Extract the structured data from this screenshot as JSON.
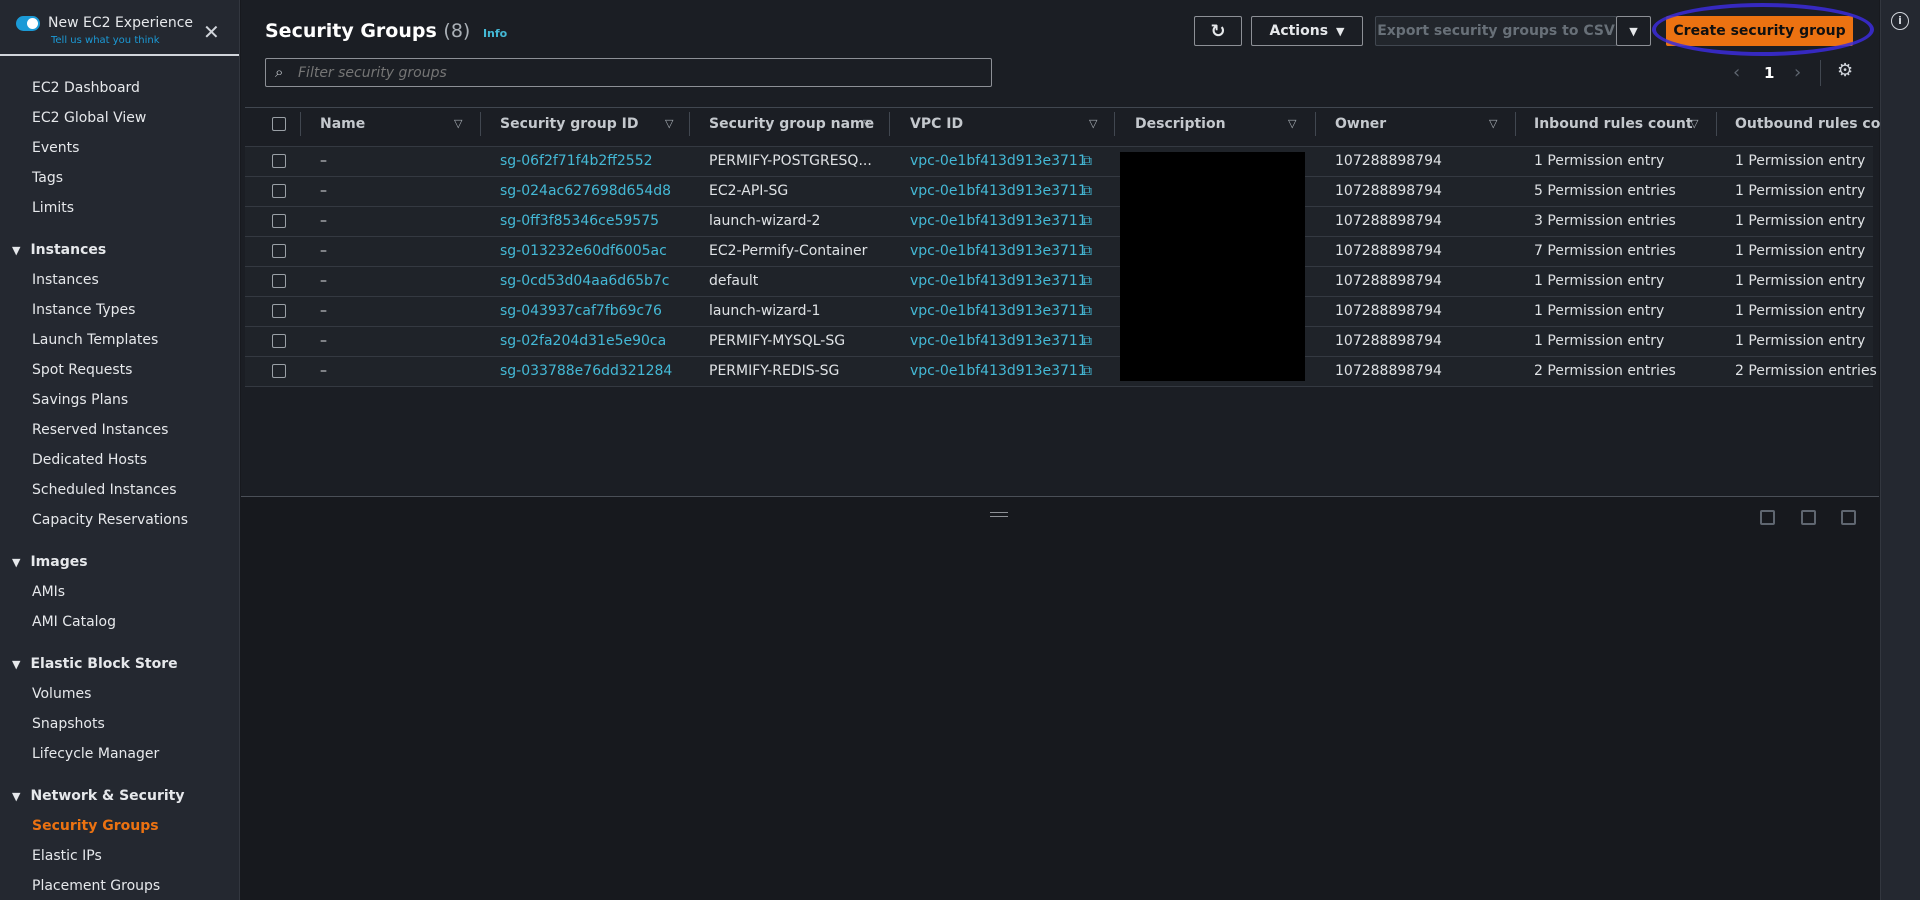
{
  "sidebar": {
    "toggle_label": "New EC2 Experience",
    "feedback_link": "Tell us what you think",
    "items": [
      {
        "label": "EC2 Dashboard",
        "type": "item"
      },
      {
        "label": "EC2 Global View",
        "type": "item"
      },
      {
        "label": "Events",
        "type": "item"
      },
      {
        "label": "Tags",
        "type": "item"
      },
      {
        "label": "Limits",
        "type": "item"
      },
      {
        "label": "Instances",
        "type": "section"
      },
      {
        "label": "Instances",
        "type": "item"
      },
      {
        "label": "Instance Types",
        "type": "item"
      },
      {
        "label": "Launch Templates",
        "type": "item"
      },
      {
        "label": "Spot Requests",
        "type": "item"
      },
      {
        "label": "Savings Plans",
        "type": "item"
      },
      {
        "label": "Reserved Instances",
        "type": "item"
      },
      {
        "label": "Dedicated Hosts",
        "type": "item"
      },
      {
        "label": "Scheduled Instances",
        "type": "item"
      },
      {
        "label": "Capacity Reservations",
        "type": "item"
      },
      {
        "label": "Images",
        "type": "section"
      },
      {
        "label": "AMIs",
        "type": "item"
      },
      {
        "label": "AMI Catalog",
        "type": "item"
      },
      {
        "label": "Elastic Block Store",
        "type": "section"
      },
      {
        "label": "Volumes",
        "type": "item"
      },
      {
        "label": "Snapshots",
        "type": "item"
      },
      {
        "label": "Lifecycle Manager",
        "type": "item"
      },
      {
        "label": "Network & Security",
        "type": "section"
      },
      {
        "label": "Security Groups",
        "type": "item",
        "active": true
      },
      {
        "label": "Elastic IPs",
        "type": "item"
      },
      {
        "label": "Placement Groups",
        "type": "item"
      }
    ]
  },
  "header": {
    "title": "Security Groups",
    "count": "(8)",
    "info": "Info"
  },
  "toolbar": {
    "actions": "Actions",
    "export": "Export security groups to CSV",
    "create": "Create security group"
  },
  "filter": {
    "placeholder": "Filter security groups",
    "value": ""
  },
  "pagination": {
    "page": "1"
  },
  "table": {
    "columns": [
      "Name",
      "Security group ID",
      "Security group name",
      "VPC ID",
      "Description",
      "Owner",
      "Inbound rules count",
      "Outbound rules co..."
    ],
    "rows": [
      [
        "–",
        "sg-06f2f71f4b2ff2552",
        "PERMIFY-POSTGRESQ...",
        "vpc-0e1bf413d913e3711",
        "",
        "107288898794",
        "1 Permission entry",
        "1 Permission entry"
      ],
      [
        "–",
        "sg-024ac627698d654d8",
        "EC2-API-SG",
        "vpc-0e1bf413d913e3711",
        "",
        "107288898794",
        "5 Permission entries",
        "1 Permission entry"
      ],
      [
        "–",
        "sg-0ff3f85346ce59575",
        "launch-wizard-2",
        "vpc-0e1bf413d913e3711",
        "",
        "107288898794",
        "3 Permission entries",
        "1 Permission entry"
      ],
      [
        "–",
        "sg-013232e60df6005ac",
        "EC2-Permify-Container",
        "vpc-0e1bf413d913e3711",
        "",
        "107288898794",
        "7 Permission entries",
        "1 Permission entry"
      ],
      [
        "–",
        "sg-0cd53d04aa6d65b7c",
        "default",
        "vpc-0e1bf413d913e3711",
        "",
        "107288898794",
        "1 Permission entry",
        "1 Permission entry"
      ],
      [
        "–",
        "sg-043937caf7fb69c76",
        "launch-wizard-1",
        "vpc-0e1bf413d913e3711",
        "",
        "107288898794",
        "1 Permission entry",
        "1 Permission entry"
      ],
      [
        "–",
        "sg-02fa204d31e5e90ca",
        "PERMIFY-MYSQL-SG",
        "vpc-0e1bf413d913e3711",
        "",
        "107288898794",
        "1 Permission entry",
        "1 Permission entry"
      ],
      [
        "–",
        "sg-033788e76dd321284",
        "PERMIFY-REDIS-SG",
        "vpc-0e1bf413d913e3711",
        "",
        "107288898794",
        "2 Permission entries",
        "2 Permission entries"
      ]
    ]
  },
  "colors": {
    "accent": "#ec7211",
    "link": "#44b9d6",
    "annotation": "#3b2bdc"
  }
}
